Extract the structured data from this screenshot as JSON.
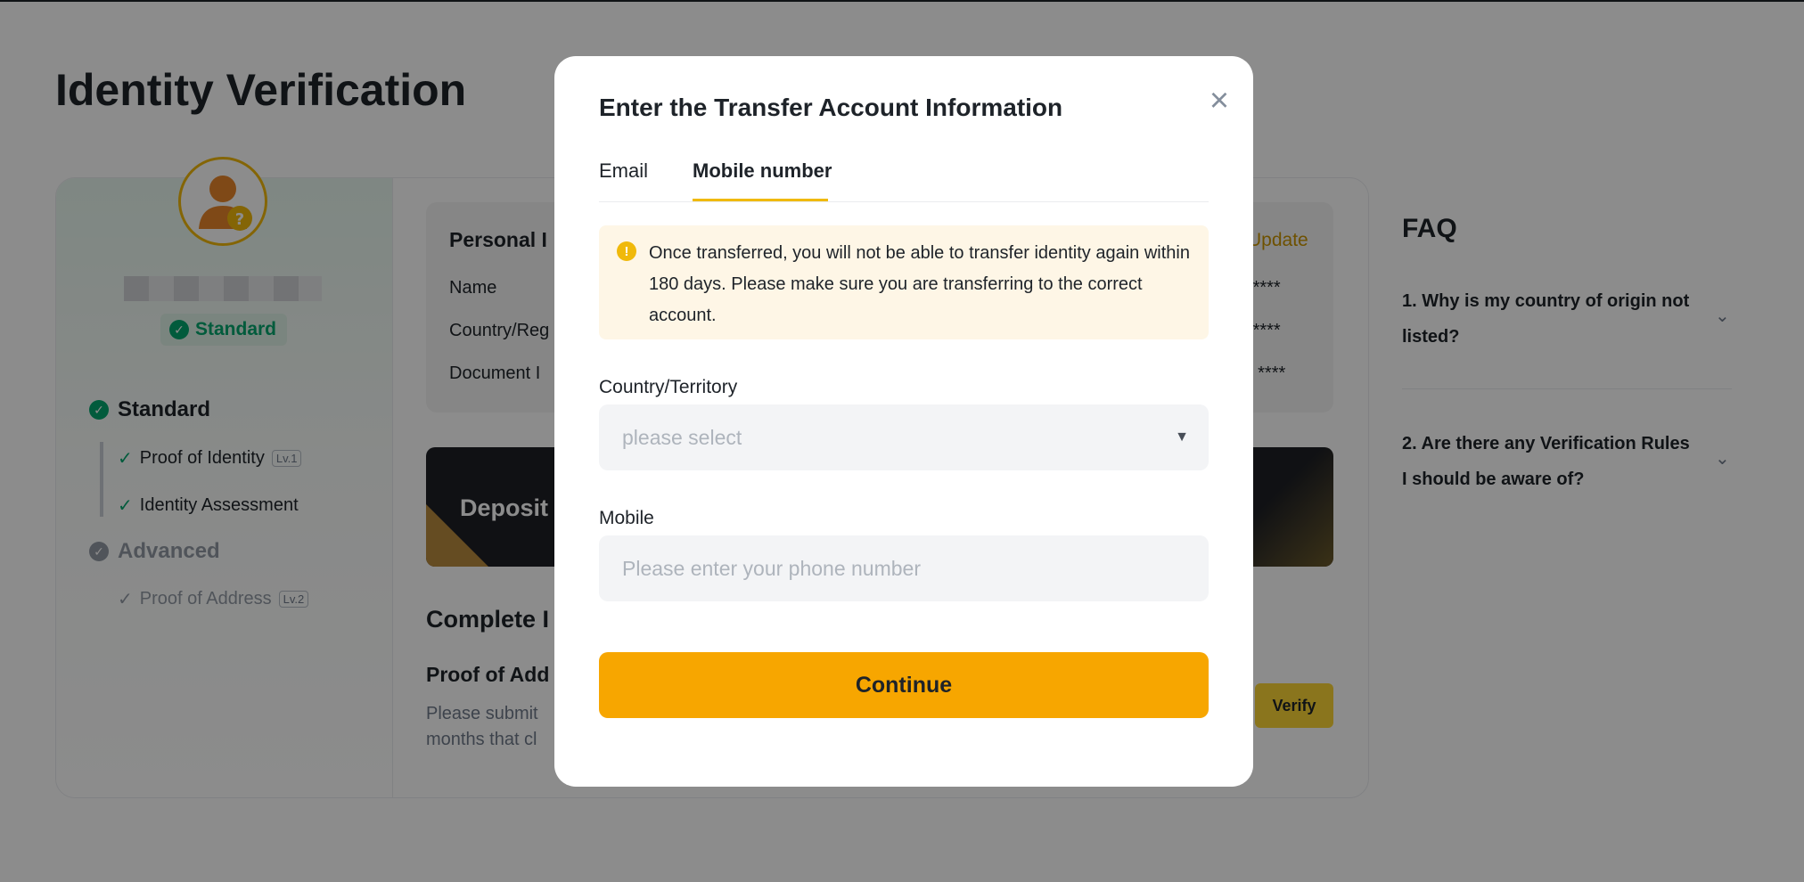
{
  "page": {
    "title": "Identity Verification"
  },
  "sidebar": {
    "badge_label": "Standard",
    "levels": [
      {
        "label": "Standard",
        "items": [
          {
            "label": "Proof of Identity",
            "tag": "Lv.1"
          },
          {
            "label": "Identity Assessment"
          }
        ]
      },
      {
        "label": "Advanced",
        "items": [
          {
            "label": "Proof of Address",
            "tag": "Lv.2"
          }
        ]
      }
    ]
  },
  "personal_info": {
    "title": "Personal I",
    "update_label": "Update",
    "rows": [
      {
        "label": "Name",
        "value": "******"
      },
      {
        "label": "Country/Reg",
        "value": "******"
      },
      {
        "label": "Document I",
        "value": "** ****"
      }
    ]
  },
  "deposit_banner": {
    "label": "Deposit"
  },
  "complete": {
    "title": "Complete I",
    "poa_title": "Proof of Add",
    "poa_desc_line1": "Please submit",
    "poa_desc_line2": "months that cl",
    "verify_label": "Verify"
  },
  "faq": {
    "title": "FAQ",
    "items": [
      {
        "q1": "1. Why is my country of origin not",
        "q2": "listed?"
      },
      {
        "q1": "2. Are there any Verification Rules",
        "q2": "I should be aware of?"
      }
    ]
  },
  "modal": {
    "title": "Enter the Transfer Account Information",
    "tabs": [
      {
        "label": "Email",
        "active": false
      },
      {
        "label": "Mobile number",
        "active": true
      }
    ],
    "warning": "Once transferred, you will not be able to transfer identity again within 180 days. Please make sure you are transferring to the correct account.",
    "country": {
      "label": "Country/Territory",
      "placeholder": "please select"
    },
    "mobile": {
      "label": "Mobile",
      "placeholder": "Please enter your phone number"
    },
    "continue_label": "Continue"
  },
  "colors": {
    "accent": "#F7A600",
    "success": "#03A66D",
    "warning_bg": "#FEF6E6"
  },
  "icons": {
    "close": "close-icon",
    "warning": "warning-icon",
    "dropdown": "caret-down-icon",
    "check": "check-icon"
  }
}
